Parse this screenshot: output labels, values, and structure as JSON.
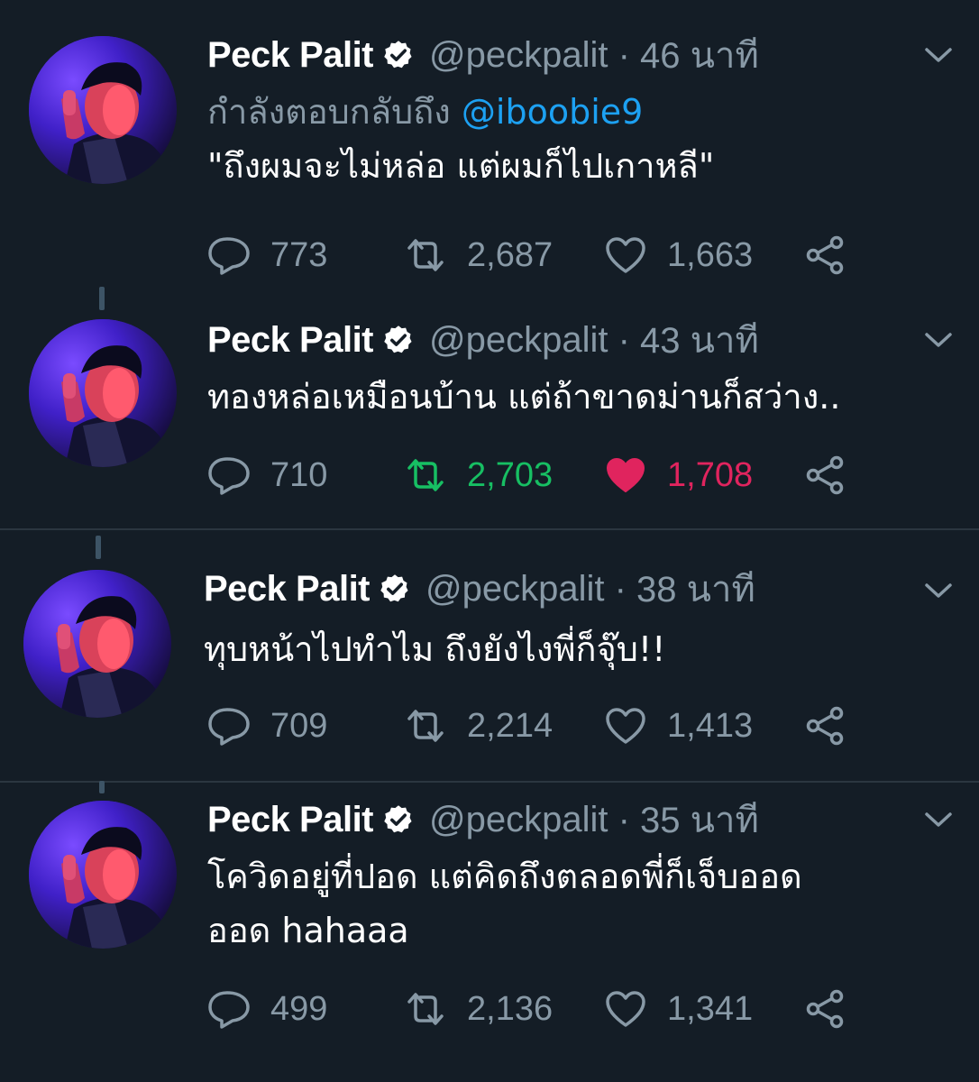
{
  "tweets": [
    {
      "name": "Peck Palit",
      "handle": "@peckpalit",
      "time": "46 นาที",
      "reply_prefix": "กำลังตอบกลับถึง",
      "reply_to": "@iboobie9",
      "text": "\"ถึงผมจะไม่หล่อ แต่ผมก็ไปเกาหลี\"",
      "replies": "773",
      "retweets": "2,687",
      "likes": "1,663",
      "retweeted": false,
      "liked": false
    },
    {
      "name": "Peck Palit",
      "handle": "@peckpalit",
      "time": "43 นาที",
      "text": "ทองหล่อเหมือนบ้าน แต่ถ้าขาดม่านก็สว่าง..",
      "replies": "710",
      "retweets": "2,703",
      "likes": "1,708",
      "retweeted": true,
      "liked": true
    },
    {
      "name": "Peck Palit",
      "handle": "@peckpalit",
      "time": "38 นาที",
      "text": "ทุบหน้าไปทำไม ถึงยังไงพี่ก็จุ๊บ!!",
      "replies": "709",
      "retweets": "2,214",
      "likes": "1,413",
      "retweeted": false,
      "liked": false
    },
    {
      "name": "Peck Palit",
      "handle": "@peckpalit",
      "time": "35 นาที",
      "text_line1": "โควิดอยู่ที่ปอด แต่คิดถึงตลอดพี่ก็เจ็บออด",
      "text_line2": "ออด hahaaa",
      "replies": "499",
      "retweets": "2,136",
      "likes": "1,341",
      "retweeted": false,
      "liked": false
    }
  ],
  "colors": {
    "background": "#141d26",
    "secondary_text": "#8899a6",
    "mention": "#1da1f2",
    "retweet_active": "#17bf63",
    "like_active": "#e0245e"
  },
  "icons": [
    "verified-badge-icon",
    "chevron-down-icon",
    "reply-icon",
    "retweet-icon",
    "like-icon",
    "share-icon"
  ]
}
